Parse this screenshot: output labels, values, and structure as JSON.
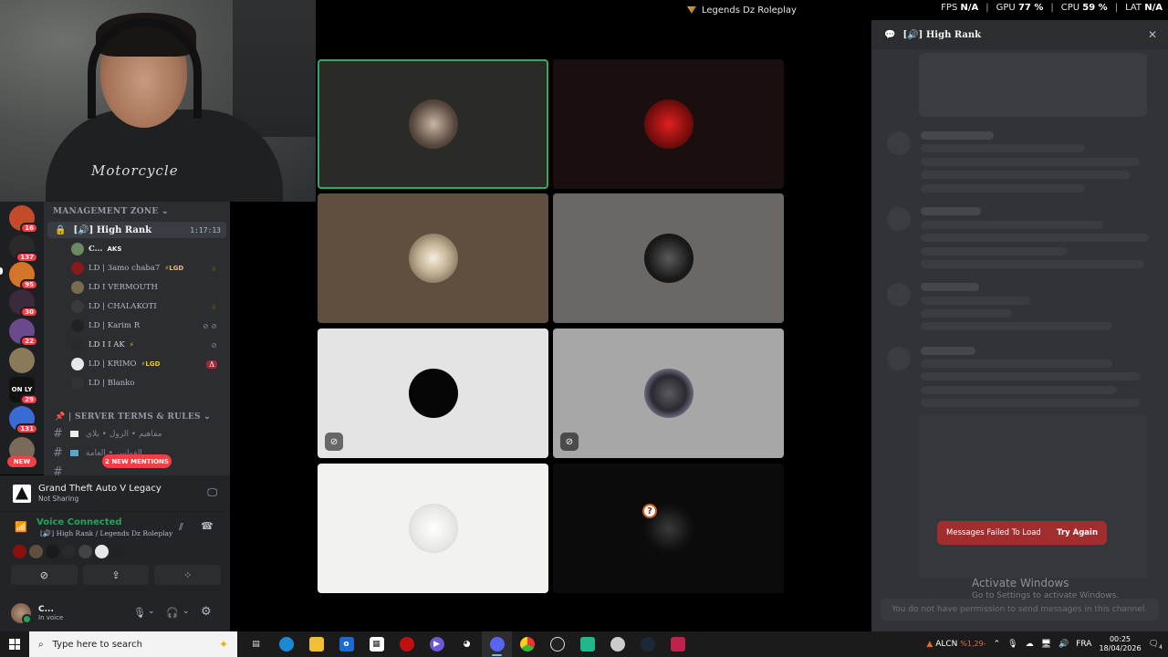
{
  "window": {
    "title": "Legends Dz Roleplay"
  },
  "overlay": {
    "fps_label": "FPS",
    "fps_value": "N/A",
    "gpu_label": "GPU",
    "gpu_value": "77 %",
    "cpu_label": "CPU",
    "cpu_value": "59 %",
    "lat_label": "LAT",
    "lat_value": "N/A",
    "sep": "|"
  },
  "webcam": {
    "shirt_text": "Motorcycle"
  },
  "servers": [
    {
      "badge": "16",
      "color": "#c44b2a"
    },
    {
      "badge": "137",
      "color": "#2a2a2a"
    },
    {
      "badge": "95",
      "color": "#d4752a"
    },
    {
      "badge": "30",
      "color": "#3a2a3a"
    },
    {
      "badge": "22",
      "color": "#6a4a8a"
    },
    {
      "badge": "",
      "color": "#8a7a5a"
    },
    {
      "badge": "29",
      "color": "#111111",
      "text": "ON LY"
    },
    {
      "badge": "131",
      "color": "#3a6ad4"
    },
    {
      "badge": "",
      "color": "#7a6a5a"
    }
  ],
  "new_pill": "NEW",
  "channels": {
    "category1": "MANAGEMENT ZONE",
    "voice_channel": {
      "name": "[🔊] High Rank",
      "timer": "1:17:13"
    },
    "members": [
      {
        "name": "C...",
        "tag": "AKS",
        "color": "#6b8a60"
      },
      {
        "name": "LD | 3amo chaba7",
        "tag": "⚡LGD",
        "color": "#8a1a1a",
        "right": "♛"
      },
      {
        "name": "LD I VERMOUTH",
        "tag": "",
        "color": "#7a6a50"
      },
      {
        "name": "LD | CHALAKOTI",
        "tag": "",
        "color": "#3a3a3a",
        "right": "♛"
      },
      {
        "name": "LD | Karim R",
        "tag": "",
        "color": "#222222",
        "right": "⊘ ⊘"
      },
      {
        "name": "LD I I AK",
        "tag": "⚡",
        "color": "#2a2a2a",
        "right": "⊘"
      },
      {
        "name": "LD | KRIMO",
        "tag": "⚡LGD",
        "color": "#e8e8e8",
        "right": "Δ"
      },
      {
        "name": "LD | Blanko",
        "tag": "",
        "color": "#333333"
      }
    ],
    "category2": "| SERVER TERMS & RULES",
    "text_channels": [
      {
        "name": "مفاهيم • الرول • بلاي"
      },
      {
        "name": "القوانين • العامة"
      },
      {
        "name": ""
      }
    ],
    "mentions_pill": "2 NEW MENTIONS"
  },
  "activity": {
    "title": "Grand Theft Auto V Legacy",
    "subtitle": "Not Sharing"
  },
  "voice_connected": {
    "status": "Voice Connected",
    "location": "[🔊] High Rank / Legends Dz Roleplay"
  },
  "user": {
    "name": "C...",
    "status": "In voice"
  },
  "tiles": [
    {
      "bg": "#2a2b26",
      "avatar": "#7a6a5a",
      "speaking": true
    },
    {
      "bg": "#1a0f0f",
      "avatar": "#8a1010"
    },
    {
      "bg": "#5e4f3e",
      "avatar": "#d8c8b0"
    },
    {
      "bg": "#6a6764",
      "avatar": "#1a1a1a"
    },
    {
      "bg": "#e4e4e4",
      "avatar": "#050505",
      "muted": "⊘"
    },
    {
      "bg": "#a7a7a7",
      "avatar": "#2a2a30",
      "muted": "⊘"
    },
    {
      "bg": "#f2f2ee",
      "avatar": "#f5f5f5"
    },
    {
      "bg": "#0b0b0b",
      "avatar": "#111111",
      "question": "?"
    }
  ],
  "chat": {
    "header": "[🔊] High Rank",
    "error": "Messages Failed To Load",
    "retry": "Try Again",
    "activate_title": "Activate Windows",
    "activate_sub": "Go to Settings to activate Windows.",
    "no_permission": "You do not have permission to send messages in this channel."
  },
  "taskbar": {
    "search_placeholder": "Type here to search",
    "tray_stock": "ALCN",
    "tray_change": "%1,29-",
    "lang": "FRA",
    "time": "00:25",
    "date": "18/04/2026",
    "notif_count": "4"
  }
}
